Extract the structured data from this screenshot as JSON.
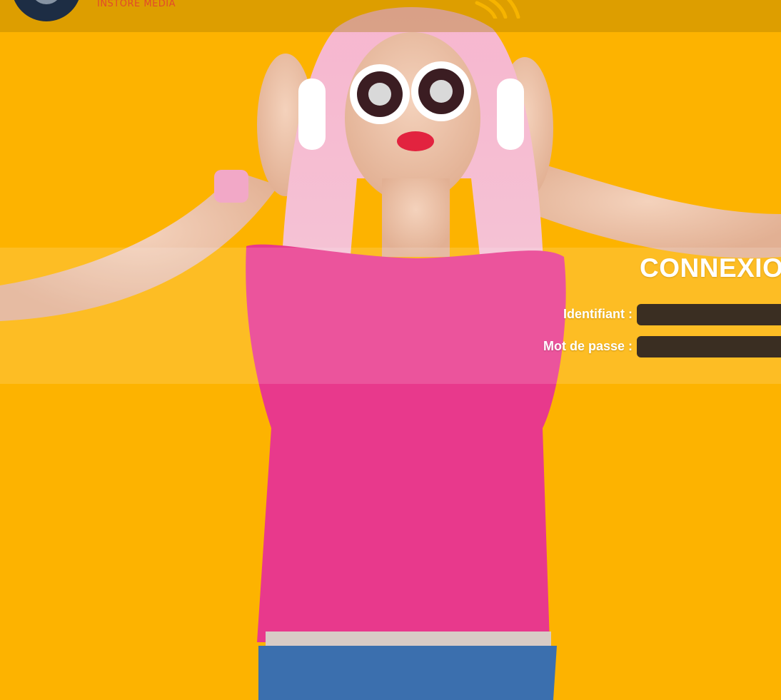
{
  "colors": {
    "background": "#fdb300",
    "header_overlay": "#a07800",
    "login_title": "#ffffff",
    "input_background": "#3a2e22",
    "logo_dark": "#1d2d44",
    "logo_sub": "#e2492b",
    "shirt_pink": "#e8398c"
  },
  "header": {
    "logo_subtitle": "INSTORE MEDIA",
    "logo_icon": "circle-logo-icon",
    "wave_icon": "radio-wave-icon"
  },
  "login": {
    "title": "CONNEXION",
    "username_label": "Identifiant :",
    "password_label": "Mot de passe :",
    "username_value": "",
    "password_value": ""
  }
}
